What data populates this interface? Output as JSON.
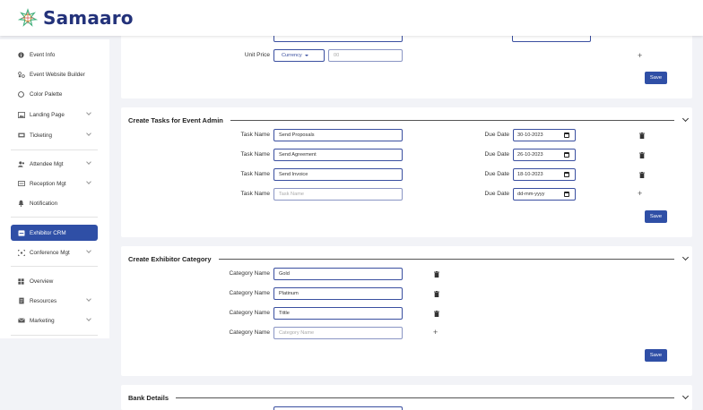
{
  "app": {
    "brand": "Samaaro"
  },
  "sidebar": {
    "items": [
      {
        "label": "Event Info",
        "icon": "info-icon"
      },
      {
        "label": "Event Website Builder",
        "icon": "website-builder-icon"
      },
      {
        "label": "Color Palette",
        "icon": "palette-icon"
      },
      {
        "label": "Landing Page",
        "icon": "image-icon"
      },
      {
        "label": "Ticketing",
        "icon": "ticket-icon"
      },
      {
        "label": "Attendee Mgt",
        "icon": "users-icon"
      },
      {
        "label": "Reception Mgt",
        "icon": "reception-icon"
      },
      {
        "label": "Notification",
        "icon": "bell-icon"
      },
      {
        "label": "Exhibitor CRM",
        "icon": "crm-icon"
      },
      {
        "label": "Conference Mgt",
        "icon": "conference-icon"
      },
      {
        "label": "Overview",
        "icon": "grid-icon"
      },
      {
        "label": "Resources",
        "icon": "document-icon"
      },
      {
        "label": "Marketing",
        "icon": "mail-icon"
      }
    ]
  },
  "price_card": {
    "unit_price_label": "Unit Price",
    "currency_label": "Currency",
    "price_value": "00",
    "save_label": "Save"
  },
  "tasks_card": {
    "title": "Create Tasks for Event Admin",
    "task_label": "Task Name",
    "due_label": "Due Date",
    "rows": [
      {
        "name": "Send Proposals",
        "due": "30-10-2023"
      },
      {
        "name": "Send Agreement",
        "due": "26-10-2023"
      },
      {
        "name": "Send Invoice",
        "due": "18-10-2023"
      }
    ],
    "new_task_placeholder": "Task Name",
    "new_due_placeholder": "dd-mm-yyyy",
    "save_label": "Save"
  },
  "category_card": {
    "title": "Create Exhibitor Category",
    "category_label": "Category Name",
    "rows": [
      {
        "name": "Gold"
      },
      {
        "name": "Platinum"
      },
      {
        "name": "Tittle"
      }
    ],
    "new_placeholder": "Category Name",
    "save_label": "Save"
  },
  "bank_card": {
    "title": "Bank Details"
  },
  "colors": {
    "brand": "#23327a",
    "accent": "#2f4fa6",
    "field_border": "#3a4fa0"
  }
}
